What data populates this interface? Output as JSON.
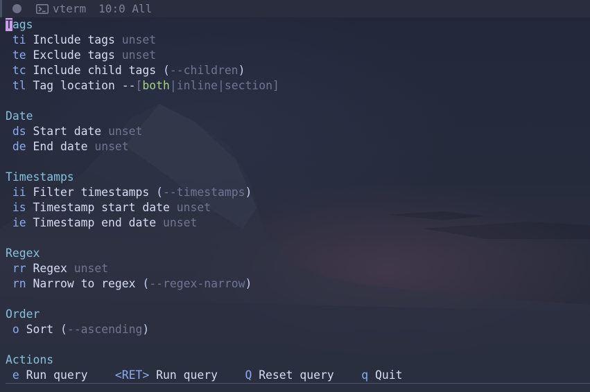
{
  "modeline": {
    "buffer_name": "vterm",
    "position": "10:0",
    "scroll": "All",
    "buffer_icon": "terminal-icon"
  },
  "sections": {
    "tags": {
      "title_cursor_char": "T",
      "title_rest": "ags",
      "items": [
        {
          "key": "ti",
          "label": "Include tags",
          "value": "unset"
        },
        {
          "key": "te",
          "label": "Exclude tags",
          "value": "unset"
        },
        {
          "key": "tc",
          "label": "Include child tags",
          "open": "(",
          "switch": "--children",
          "close": ")"
        },
        {
          "key": "tl",
          "label": "Tag location",
          "prefix": "--",
          "lb": "[",
          "opt1": "both",
          "bar1": "|",
          "opt2": "inline",
          "bar2": "|",
          "opt3": "section",
          "rb": "]"
        }
      ]
    },
    "date": {
      "title": "Date",
      "items": [
        {
          "key": "ds",
          "label": "Start date",
          "value": "unset"
        },
        {
          "key": "de",
          "label": "End date",
          "value": "unset"
        }
      ]
    },
    "timestamps": {
      "title": "Timestamps",
      "items": [
        {
          "key": "ii",
          "label": "Filter timestamps",
          "open": "(",
          "switch": "--timestamps",
          "close": ")"
        },
        {
          "key": "is",
          "label": "Timestamp start date",
          "value": "unset"
        },
        {
          "key": "ie",
          "label": "Timestamp end date",
          "value": "unset"
        }
      ]
    },
    "regex": {
      "title": "Regex",
      "items": [
        {
          "key": "rr",
          "label": "Regex",
          "value": "unset"
        },
        {
          "key": "rn",
          "label": "Narrow to regex",
          "open": "(",
          "switch": "--regex-narrow",
          "close": ")"
        }
      ]
    },
    "order": {
      "title": "Order",
      "items": [
        {
          "key": "o",
          "label": "Sort",
          "open": "(",
          "switch": "--ascending",
          "close": ")"
        }
      ]
    },
    "actions": {
      "title": "Actions",
      "items": [
        {
          "key": "e",
          "label": "Run query"
        },
        {
          "key": "<RET>",
          "label": "Run query"
        },
        {
          "key": "Q",
          "label": "Reset query"
        },
        {
          "key": "q",
          "label": "Quit"
        }
      ]
    }
  },
  "colors": {
    "background": "#232634",
    "heading": "#85c1dc",
    "key": "#8caaee",
    "label": "#d6dcf5",
    "dim": "#6f7694",
    "active_choice": "#a6d189",
    "cursor": "#ca9ee6"
  }
}
